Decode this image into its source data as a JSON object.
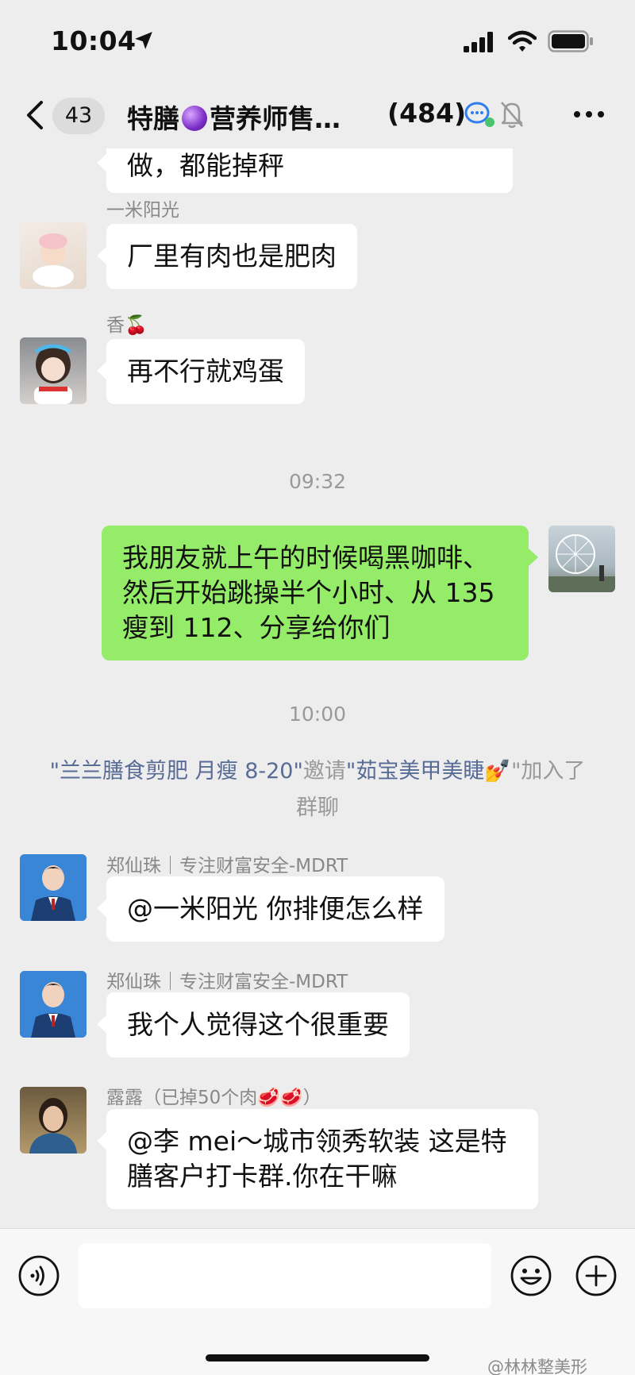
{
  "status_bar": {
    "time": "10:04"
  },
  "nav": {
    "unread_count": "43",
    "title_part1": "特膳",
    "title_part2": "营养师售…",
    "member_count": "(484)"
  },
  "messages": [
    {
      "text": "做，都能掉秤"
    },
    {
      "sender": "一米阳光",
      "text": "厂里有肉也是肥肉"
    },
    {
      "sender": "香",
      "sender_emoji": "🍒",
      "text": "再不行就鸡蛋"
    },
    {
      "timestamp": "09:32"
    },
    {
      "self": true,
      "lines": [
        "我朋友就上午的时候喝黑咖啡、",
        "然后开始跳操半个小时、从 135",
        "瘦到 112、分享给你们"
      ]
    },
    {
      "timestamp": "10:00"
    },
    {
      "system": {
        "inviter": "\"兰兰膳食剪肥 月瘦 8-20\"",
        "invite_word": "邀请",
        "invitee": "\"茹宝美甲美睫",
        "invitee_emoji": "💅",
        "tail": "\"加入了群聊"
      }
    },
    {
      "sender": "郑仙珠｜专注财富安全-MDRT",
      "text": "@一米阳光 你排便怎么样"
    },
    {
      "sender": "郑仙珠｜专注财富安全-MDRT",
      "text": "我个人觉得这个很重要"
    },
    {
      "sender": "露露（已掉50个肉",
      "sender_emoji": "🥩🥩",
      "sender_tail": "）",
      "lines": [
        "@李 mei～城市领秀软装 这是特",
        "膳客户打卡群.你在干嘛"
      ]
    }
  ],
  "watermark": "@林林整美形",
  "colors": {
    "background": "#ededed",
    "self_bubble": "#95ec69",
    "other_bubble": "#ffffff",
    "system_link": "#576b95"
  }
}
